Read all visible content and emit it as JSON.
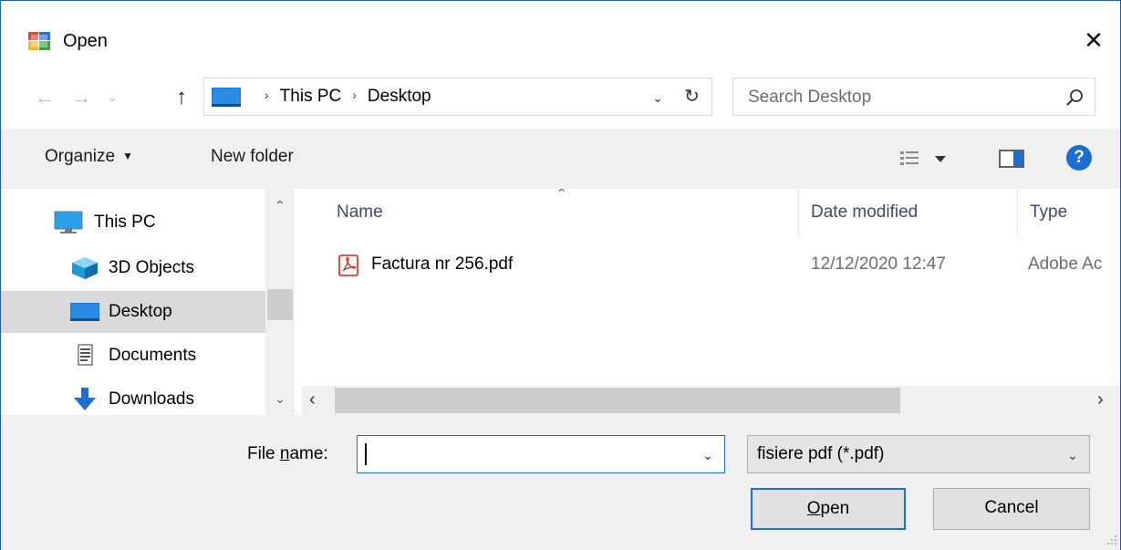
{
  "window": {
    "title": "Open",
    "close_glyph": "✕"
  },
  "nav": {
    "back_glyph": "←",
    "forward_glyph": "→",
    "recent_glyph": "⌄",
    "up_glyph": "↑",
    "breadcrumb": [
      "This PC",
      "Desktop"
    ],
    "breadcrumb_sep": "›",
    "address_dropdown_glyph": "⌄",
    "refresh_glyph": "↻"
  },
  "search": {
    "placeholder": "Search Desktop"
  },
  "toolbar": {
    "organize_label": "Organize",
    "organize_caret": "▼",
    "new_folder_label": "New folder",
    "help_label": "?"
  },
  "navpane": {
    "items": [
      {
        "label": "This PC",
        "icon": "this-pc-icon"
      },
      {
        "label": "3D Objects",
        "icon": "3d-objects-icon"
      },
      {
        "label": "Desktop",
        "icon": "desktop-icon",
        "selected": true
      },
      {
        "label": "Documents",
        "icon": "documents-icon"
      },
      {
        "label": "Downloads",
        "icon": "downloads-icon"
      }
    ],
    "scroll_up_glyph": "⌃",
    "scroll_down_glyph": "⌄"
  },
  "filelist": {
    "columns": [
      "Name",
      "Date modified",
      "Type"
    ],
    "sort_glyph": "⌃",
    "rows": [
      {
        "name": "Factura nr 256.pdf",
        "date": "12/12/2020 12:47",
        "type": "Adobe Ac",
        "icon": "pdf-icon"
      }
    ],
    "scroll_left_glyph": "‹",
    "scroll_right_glyph": "›"
  },
  "bottom": {
    "file_name_label_pre": "File ",
    "file_name_label_ul": "n",
    "file_name_label_post": "ame:",
    "file_name_value": "",
    "file_name_dropdown_glyph": "⌄",
    "filter_value": "fisiere pdf (*.pdf)",
    "filter_dropdown_glyph": "⌄",
    "open_ul": "O",
    "open_rest": "pen",
    "cancel_label": "Cancel"
  },
  "colors": {
    "accent": "#1e6fd1",
    "toolbar_bg": "#f0f0f0",
    "selected_bg": "#d9d9d9",
    "header_text": "#3c4d69",
    "pdf_red": "#d4251d"
  }
}
